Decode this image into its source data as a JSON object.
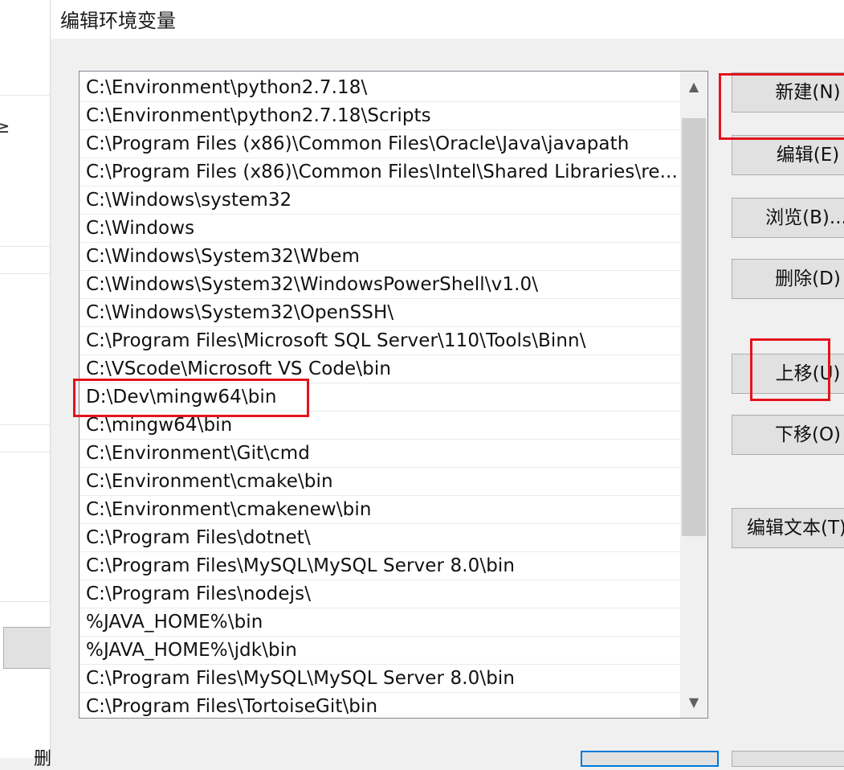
{
  "dialog": {
    "title": "编辑环境变量"
  },
  "backdrop": {
    "glyph": "≥",
    "bottom_glyph": "删"
  },
  "path_list": [
    "C:\\Environment\\python2.7.18\\",
    "C:\\Environment\\python2.7.18\\Scripts",
    "C:\\Program Files (x86)\\Common Files\\Oracle\\Java\\javapath",
    "C:\\Program Files (x86)\\Common Files\\Intel\\Shared Libraries\\re...",
    "C:\\Windows\\system32",
    "C:\\Windows",
    "C:\\Windows\\System32\\Wbem",
    "C:\\Windows\\System32\\WindowsPowerShell\\v1.0\\",
    "C:\\Windows\\System32\\OpenSSH\\",
    "C:\\Program Files\\Microsoft SQL Server\\110\\Tools\\Binn\\",
    "C:\\VScode\\Microsoft VS Code\\bin",
    "D:\\Dev\\mingw64\\bin",
    "C:\\mingw64\\bin",
    "C:\\Environment\\Git\\cmd",
    "C:\\Environment\\cmake\\bin",
    "C:\\Environment\\cmakenew\\bin",
    "C:\\Program Files\\dotnet\\",
    "C:\\Program Files\\MySQL\\MySQL Server 8.0\\bin",
    "C:\\Program Files\\nodejs\\",
    "%JAVA_HOME%\\bin",
    "%JAVA_HOME%\\jdk\\bin",
    "C:\\Program Files\\MySQL\\MySQL Server 8.0\\bin",
    "C:\\Program Files\\TortoiseGit\\bin"
  ],
  "buttons": {
    "new": "新建(N)",
    "edit": "编辑(E)",
    "browse": "浏览(B)...",
    "delete": "删除(D)",
    "move_up": "上移(U)",
    "move_down": "下移(O)",
    "edit_text": "编辑文本(T)"
  },
  "scrollbar": {
    "up_icon": "▲",
    "down_icon": "▼"
  },
  "annotation_color": "#e3131c",
  "highlighted_entry": "D:\\Dev\\mingw64\\bin"
}
